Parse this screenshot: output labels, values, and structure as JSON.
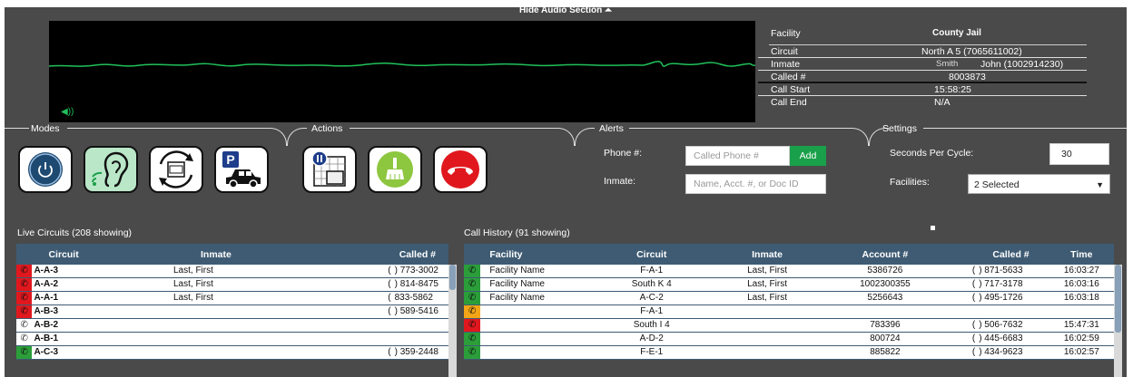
{
  "audio": {
    "hide_label": "Hide Audio Section ⏶",
    "volume_icon": "speaker-icon"
  },
  "call_info": {
    "facility_label": "Facility",
    "facility_value": "County Jail",
    "circuit_label": "Circuit",
    "circuit_value": "North A 5 (7065611002)",
    "inmate_label": "Inmate",
    "inmate_value_a": "Smith",
    "inmate_value_b": "John (1002914230)",
    "called_label": "Called #",
    "called_value": "8003873",
    "call_start_label": "Call Start",
    "call_start_value": "15:58:25",
    "call_end_label": "Call End",
    "call_end_value": "N/A"
  },
  "sections": {
    "modes": "Modes",
    "actions": "Actions",
    "alerts": "Alerts",
    "settings": "Settings"
  },
  "modes": [
    {
      "icon": "power-icon"
    },
    {
      "icon": "listen-ear-icon"
    },
    {
      "icon": "phone-cycle-icon"
    },
    {
      "icon": "parking-car-icon"
    }
  ],
  "actions": [
    {
      "icon": "pause-phone-icon"
    },
    {
      "icon": "broom-clear-icon"
    },
    {
      "icon": "hang-up-icon"
    }
  ],
  "alerts": {
    "phone_label": "Phone #:",
    "phone_placeholder": "Called Phone #",
    "add_label": "Add",
    "inmate_label": "Inmate:",
    "inmate_placeholder": "Name, Acct. #, or Doc ID"
  },
  "settings": {
    "seconds_label": "Seconds Per Cycle:",
    "seconds_value": "30",
    "facilities_label": "Facilities:",
    "facilities_value": "2 Selected"
  },
  "live": {
    "title": "Live Circuits (208 showing)",
    "headers": [
      "Circuit",
      "Inmate",
      "Called #"
    ],
    "rows": [
      {
        "status": "red",
        "circuit": "A-A-3",
        "inmate": "Last, First",
        "called_a": "(",
        "called_b": ") 773-3002"
      },
      {
        "status": "red",
        "circuit": "A-A-2",
        "inmate": "Last, First",
        "called_a": "(",
        "called_b": ") 814-8475"
      },
      {
        "status": "red",
        "circuit": "A-A-1",
        "inmate": "Last, First",
        "called_a": "(",
        "called_b": "833-5862"
      },
      {
        "status": "red",
        "circuit": "A-B-3",
        "inmate": "",
        "called_a": "(",
        "called_b": ") 589-5416"
      },
      {
        "status": "white",
        "circuit": "A-B-2",
        "inmate": "",
        "called_a": "",
        "called_b": ""
      },
      {
        "status": "white",
        "circuit": "A-B-1",
        "inmate": "",
        "called_a": "",
        "called_b": ""
      },
      {
        "status": "green",
        "circuit": "A-C-3",
        "inmate": "",
        "called_a": "(",
        "called_b": ") 359-2448"
      }
    ]
  },
  "history": {
    "title": "Call History (91 showing)",
    "headers": [
      "Facility",
      "Circuit",
      "Inmate",
      "Account #",
      "Called #",
      "Time"
    ],
    "rows": [
      {
        "status": "green",
        "facility": "Facility Name",
        "circuit": "F-A-1",
        "inmate": "Last, First",
        "account": "5386726",
        "called_a": "(",
        "called_b": ") 871-5633",
        "time": "16:03:27"
      },
      {
        "status": "green",
        "facility": "Facility Name",
        "circuit": "South K 4",
        "inmate": "Last, First",
        "account": "1002300355",
        "called_a": "(",
        "called_b": ") 717-3178",
        "time": "16:03:16"
      },
      {
        "status": "green",
        "facility": "Facility Name",
        "circuit": "A-C-2",
        "inmate": "Last, First",
        "account": "5256643",
        "called_a": "(",
        "called_b": ") 495-1726",
        "time": "16:03:18"
      },
      {
        "status": "orange",
        "facility": "",
        "circuit": "F-A-1",
        "inmate": "",
        "account": "",
        "called_a": "",
        "called_b": "",
        "time": ""
      },
      {
        "status": "red",
        "facility": "",
        "circuit": "South I 4",
        "inmate": "",
        "account": "783396",
        "called_a": "(",
        "called_b": ") 506-7632",
        "time": "15:47:31"
      },
      {
        "status": "green",
        "facility": "",
        "circuit": "A-D-2",
        "inmate": "",
        "account": "800724",
        "called_a": "(",
        "called_b": ") 445-6683",
        "time": "16:02:59"
      },
      {
        "status": "green",
        "facility": "",
        "circuit": "F-E-1",
        "inmate": "",
        "account": "885822",
        "called_a": "(",
        "called_b": ") 434-9623",
        "time": "16:02:57"
      }
    ]
  },
  "colors": {
    "background": "#4a4a4a",
    "table_header": "#3e5b73",
    "wave": "#21c15a",
    "add": "#1aa04a",
    "hangup": "#e0181e"
  }
}
